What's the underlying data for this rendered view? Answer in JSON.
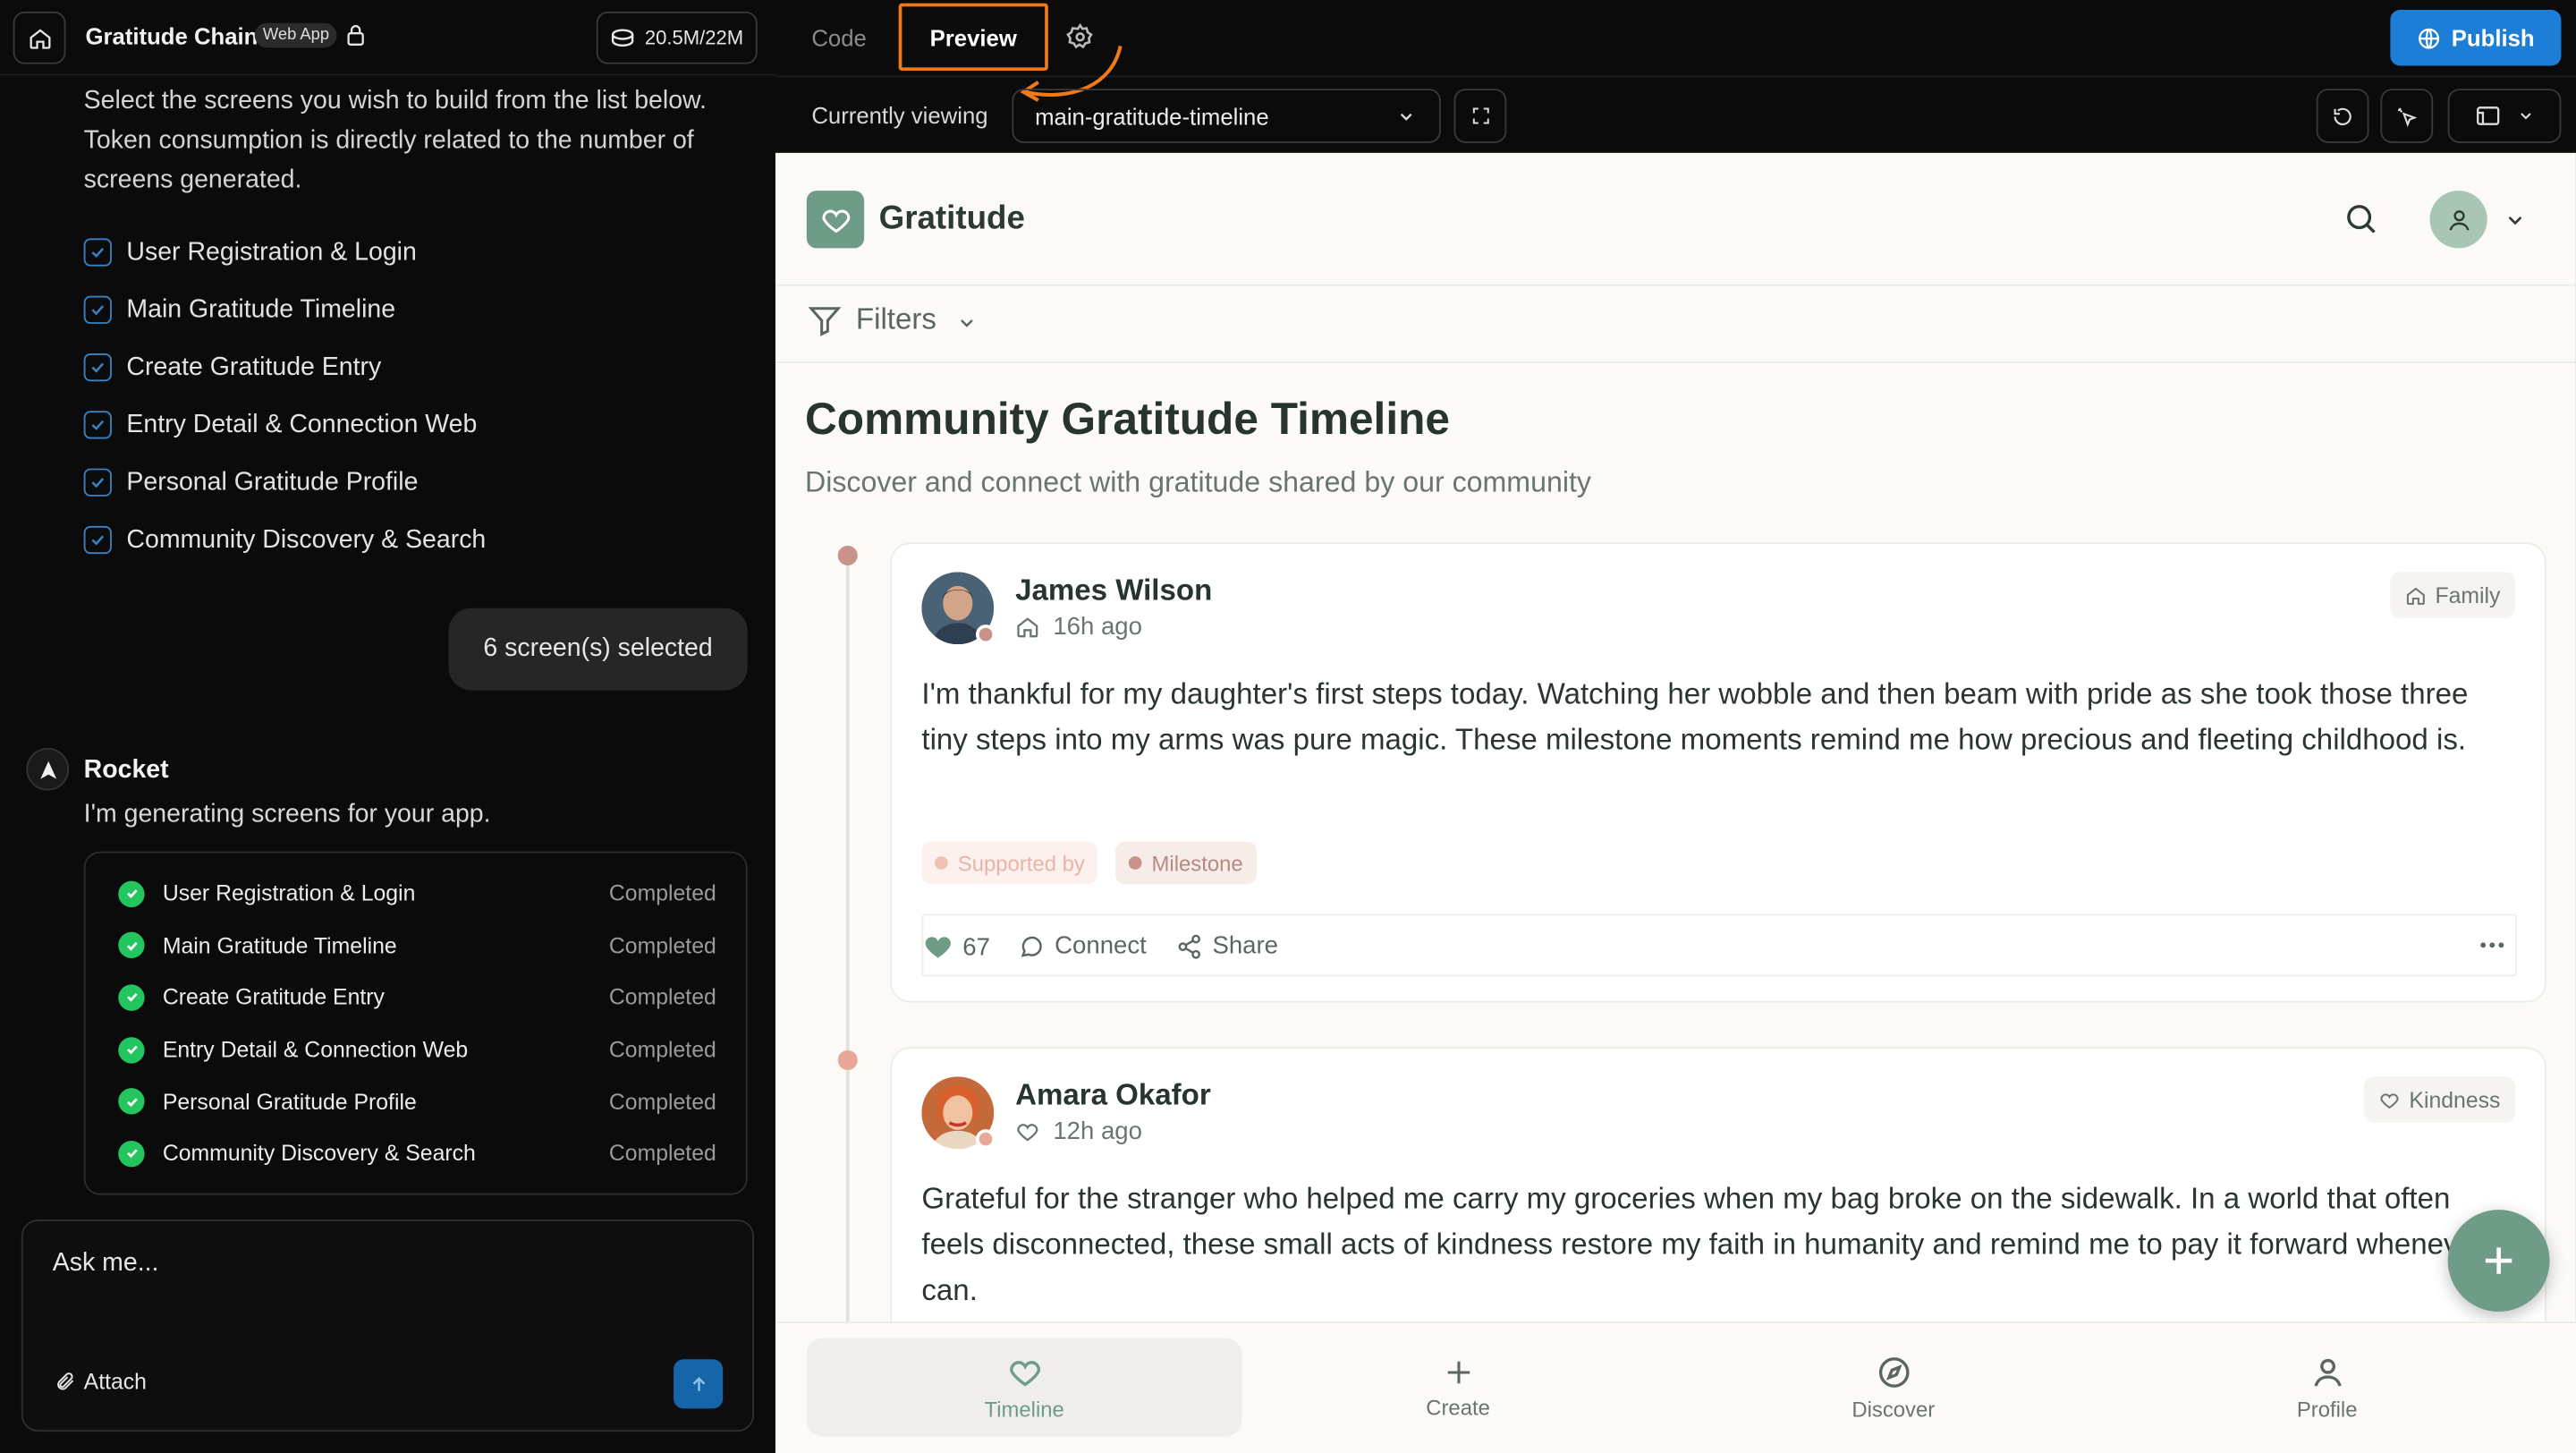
{
  "left_panel": {
    "app_name": "Gratitude Chain",
    "badge": "Web App",
    "tokens": "20.5M/22M",
    "intro": "Select the screens you wish to build from the list below. Token consumption is directly related to the number of screens generated.",
    "screens": [
      "User Registration & Login",
      "Main Gratitude Timeline",
      "Create Gratitude Entry",
      "Entry Detail & Connection Web",
      "Personal Gratitude Profile",
      "Community Discovery & Search"
    ],
    "selected_summary": "6 screen(s) selected",
    "assistant_name": "Rocket",
    "assistant_message": "I'm generating screens for your app.",
    "progress": [
      {
        "label": "User Registration & Login",
        "status": "Completed"
      },
      {
        "label": "Main Gratitude Timeline",
        "status": "Completed"
      },
      {
        "label": "Create Gratitude Entry",
        "status": "Completed"
      },
      {
        "label": "Entry Detail & Connection Web",
        "status": "Completed"
      },
      {
        "label": "Personal Gratitude Profile",
        "status": "Completed"
      },
      {
        "label": "Community Discovery & Search",
        "status": "Completed"
      }
    ],
    "ask_placeholder": "Ask me...",
    "attach_label": "Attach"
  },
  "toolbar": {
    "tab_code": "Code",
    "tab_preview": "Preview",
    "publish": "Publish",
    "currently_viewing_label": "Currently viewing",
    "currently_viewing_value": "main-gratitude-timeline"
  },
  "preview": {
    "brand": "Gratitude",
    "filters": "Filters",
    "title": "Community Gratitude Timeline",
    "subtitle": "Discover and connect with gratitude shared by our community",
    "posts": [
      {
        "author": "James Wilson",
        "time": "16h ago",
        "tag": "Family",
        "body": "I'm thankful for my daughter's first steps today. Watching her wobble and then beam with pride as she took those three tiny steps into my arms was pure magic. These milestone moments remind me how precious and fleeting childhood is.",
        "chips": [
          "Supported by",
          "Milestone"
        ],
        "likes": "67",
        "connect": "Connect",
        "share": "Share"
      },
      {
        "author": "Amara Okafor",
        "time": "12h ago",
        "tag": "Kindness",
        "body": "Grateful for the stranger who helped me carry my groceries when my bag broke on the sidewalk. In a world that often feels disconnected, these small acts of kindness restore my faith in humanity and remind me to pay it forward whenever I can."
      }
    ],
    "nav": [
      "Timeline",
      "Create",
      "Discover",
      "Profile"
    ]
  },
  "colors": {
    "accent_orange": "#f07a1a",
    "publish_blue": "#1d7ed8",
    "brand_green": "#6f9c86",
    "completed_green": "#22c55e"
  }
}
